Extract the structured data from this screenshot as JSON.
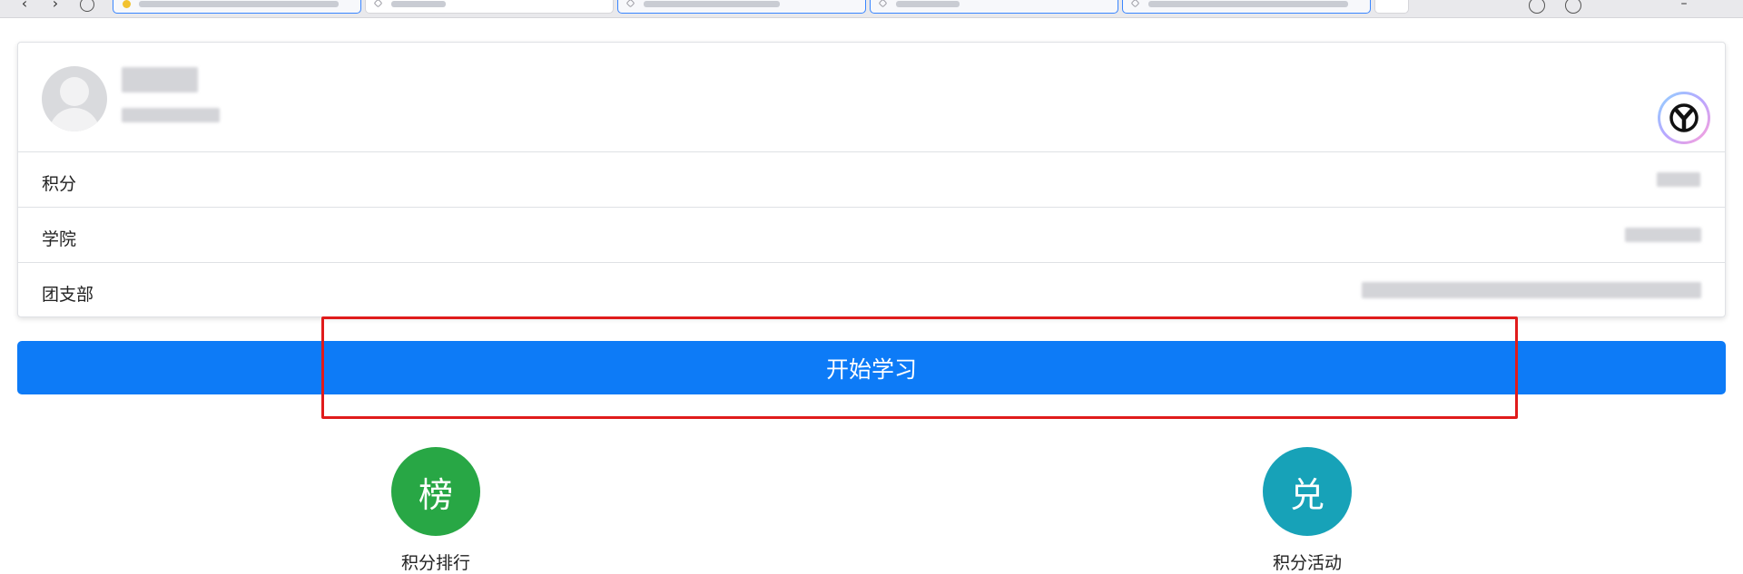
{
  "browser": {
    "tabs": [
      {
        "label": ""
      },
      {
        "label": ""
      },
      {
        "label": ""
      },
      {
        "label": ""
      },
      {
        "label": ""
      }
    ]
  },
  "profile": {
    "name": "",
    "subtitle": "",
    "rows": [
      {
        "label": "积分",
        "value": ""
      },
      {
        "label": "学院",
        "value": ""
      },
      {
        "label": "团支部",
        "value": ""
      }
    ]
  },
  "actions": {
    "start_label": "开始学习"
  },
  "shortcuts": [
    {
      "glyph": "榜",
      "label": "积分排行",
      "color": "#28a745"
    },
    {
      "glyph": "兑",
      "label": "积分活动",
      "color": "#17a2b8"
    }
  ],
  "colors": {
    "primary": "#0d7bf7",
    "highlight": "#e01b1b"
  },
  "icons": {
    "back": "back-arrow-icon",
    "forward": "forward-arrow-icon",
    "reload": "reload-icon",
    "avatar": "default-avatar-icon",
    "brand": "brand-logo-icon"
  }
}
